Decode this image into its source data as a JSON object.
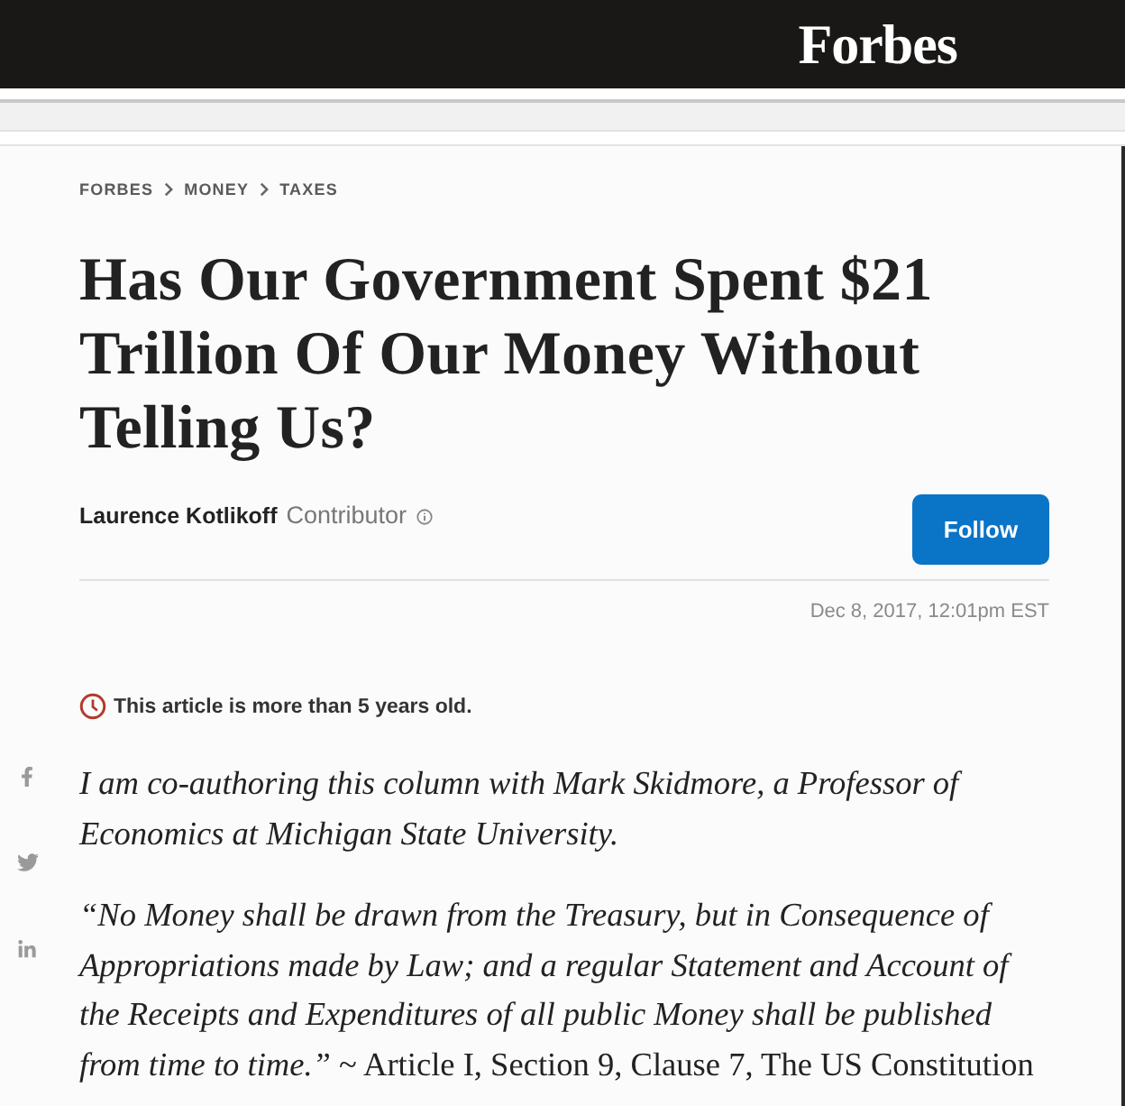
{
  "header": {
    "logo": "Forbes"
  },
  "breadcrumb": [
    "FORBES",
    "MONEY",
    "TAXES"
  ],
  "article": {
    "title": "Has Our Government Spent $21 Trillion Of Our Money Without Telling Us?",
    "author": {
      "name": "Laurence Kotlikoff",
      "role": "Contributor"
    },
    "follow_button": "Follow",
    "date": "Dec 8, 2017, 12:01pm EST",
    "age_notice": "This article is more than 5 years old.",
    "paragraphs": [
      {
        "text": "I am co-authoring this column with Mark Skidmore, a Professor of Economics at Michigan State University.",
        "italic": true
      },
      {
        "text": "*“No Money shall be drawn from the Treasury, but in Consequence of Appropriations made by Law; and a regular Statement and Account of the Receipts and Expenditures of all public Money shall be published from time to time.”* ~ Article I, Section 9, Clause 7, The US Constitution",
        "italic": false
      }
    ]
  },
  "share": [
    {
      "kind": "facebook"
    },
    {
      "kind": "twitter"
    },
    {
      "kind": "linkedin"
    }
  ]
}
